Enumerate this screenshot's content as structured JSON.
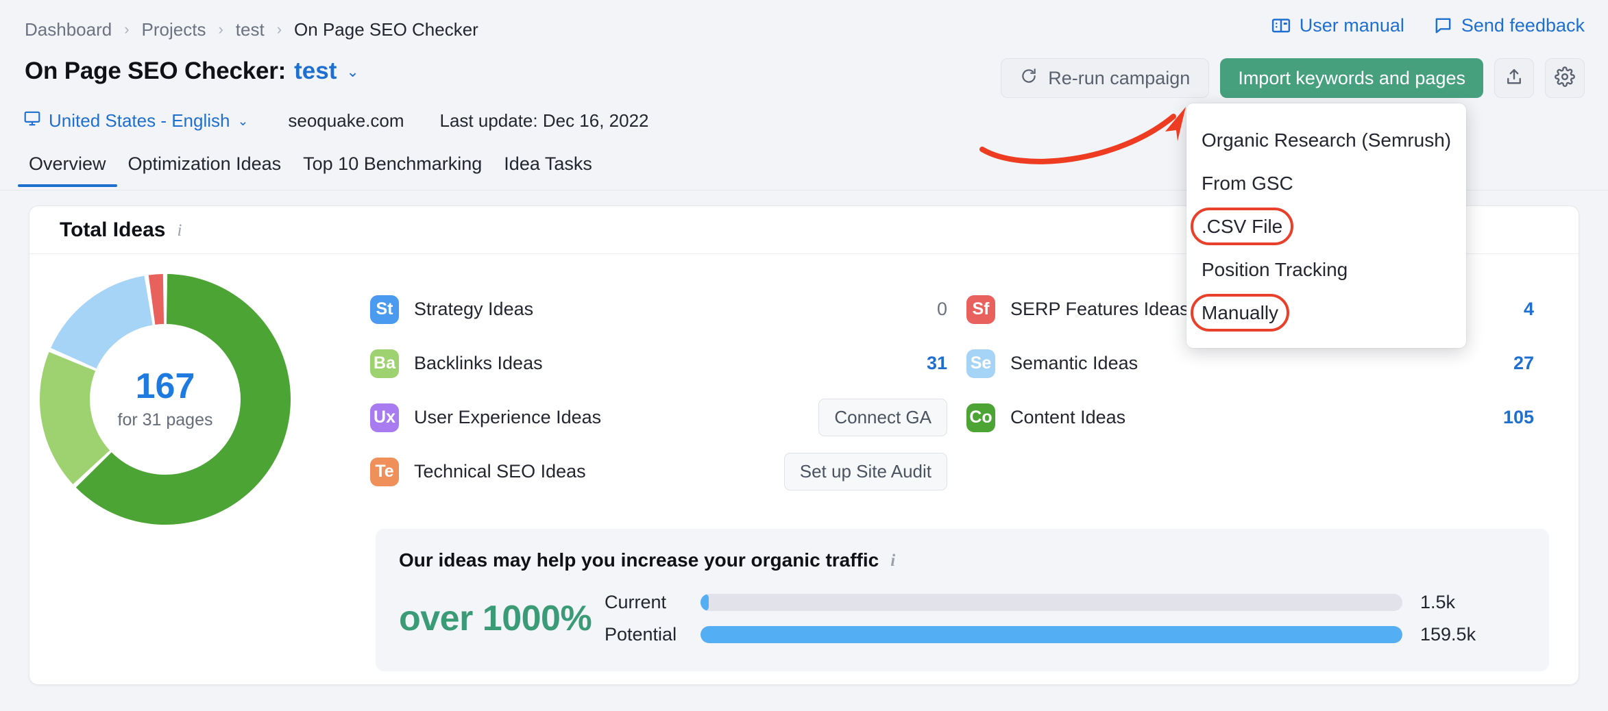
{
  "breadcrumb": {
    "items": [
      "Dashboard",
      "Projects",
      "test",
      "On Page SEO Checker"
    ],
    "separator": "›"
  },
  "top_links": [
    {
      "label": "User manual",
      "icon": "book-icon"
    },
    {
      "label": "Send feedback",
      "icon": "comment-icon"
    }
  ],
  "header": {
    "title_prefix": "On Page SEO Checker:",
    "project": "test",
    "caret": "⌄",
    "locale": "United States - English",
    "locale_caret": "⌄",
    "domain": "seoquake.com",
    "last_update": "Last update: Dec 16, 2022"
  },
  "actions": {
    "rerun_label": "Re-run campaign",
    "import_label": "Import keywords and pages",
    "export_icon": "upload-icon",
    "settings_icon": "gear-icon",
    "import_color": "#46a07e"
  },
  "dropdown": {
    "items": [
      {
        "label": "Organic Research (Semrush)",
        "highlighted": false
      },
      {
        "label": "From GSC",
        "highlighted": false
      },
      {
        "label": ".CSV File",
        "highlighted": true
      },
      {
        "label": "Position Tracking",
        "highlighted": false
      },
      {
        "label": "Manually",
        "highlighted": true
      }
    ],
    "highlight_color": "#e8402a"
  },
  "tabs": [
    {
      "label": "Overview",
      "active": true
    },
    {
      "label": "Optimization Ideas",
      "active": false
    },
    {
      "label": "Top 10 Benchmarking",
      "active": false
    },
    {
      "label": "Idea Tasks",
      "active": false
    }
  ],
  "card": {
    "title": "Total Ideas",
    "info_icon": "info-icon"
  },
  "chart_data": {
    "type": "pie",
    "title": "Total Ideas",
    "center_value": "167",
    "center_sub": "for 31 pages",
    "categories": [
      "Content Ideas",
      "Backlinks Ideas",
      "Semantic Ideas",
      "SERP Features Ideas"
    ],
    "values": [
      105,
      31,
      27,
      4
    ],
    "colors": [
      "#4ca435",
      "#9ed16f",
      "#a6d4f7",
      "#e8615c"
    ],
    "legend": "none",
    "total": 167
  },
  "ideas": {
    "left": [
      {
        "code": "St",
        "color": "#4a9bf0",
        "label": "Strategy Ideas",
        "value": "0",
        "is_zero": true,
        "button": null
      },
      {
        "code": "Ba",
        "color": "#9ed16f",
        "label": "Backlinks Ideas",
        "value": "31",
        "is_zero": false,
        "button": null
      },
      {
        "code": "Ux",
        "color": "#a97bf0",
        "label": "User Experience Ideas",
        "value": null,
        "is_zero": false,
        "button": "Connect GA"
      },
      {
        "code": "Te",
        "color": "#ef8f5a",
        "label": "Technical SEO Ideas",
        "value": null,
        "is_zero": false,
        "button": "Set up Site Audit"
      }
    ],
    "right": [
      {
        "code": "Sf",
        "color": "#e8615c",
        "label": "SERP Features Ideas",
        "value": "4",
        "is_zero": false,
        "button": null
      },
      {
        "code": "Se",
        "color": "#a6d4f7",
        "label": "Semantic Ideas",
        "value": "27",
        "is_zero": false,
        "button": null
      },
      {
        "code": "Co",
        "color": "#4ca435",
        "label": "Content Ideas",
        "value": "105",
        "is_zero": false,
        "button": null
      }
    ]
  },
  "traffic": {
    "title": "Our ideas may help you increase your organic traffic",
    "info_icon": "info-icon",
    "percent": "over 1000%",
    "percent_color": "#3c9b77",
    "chart_data": {
      "type": "bar",
      "orientation": "horizontal",
      "categories": [
        "Current",
        "Potential"
      ],
      "values": [
        1500,
        159500
      ],
      "value_labels": [
        "1.5k",
        "159.5k"
      ],
      "max": 159500,
      "bar_color": "#54aef3",
      "track_color": "#e2e3ea"
    }
  }
}
